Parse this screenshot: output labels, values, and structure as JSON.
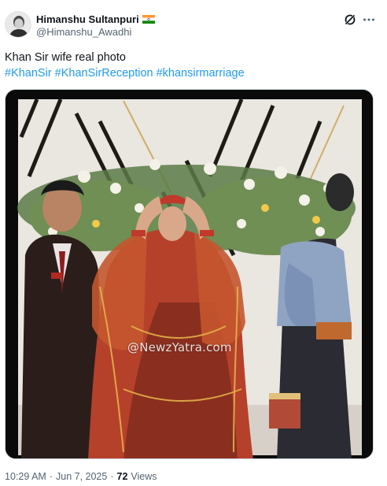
{
  "author": {
    "display_name": "Himanshu Sultanpuri",
    "handle": "@Himanshu_Awadhi"
  },
  "tweet": {
    "text": "Khan Sir wife real photo",
    "hashtags": [
      "#KhanSir",
      "#KhanSirReception",
      "#khansirmarriage"
    ]
  },
  "media": {
    "watermark": "@NewzYatra.com"
  },
  "footer": {
    "time": "10:29 AM",
    "date": "Jun 7, 2025",
    "sep": "·",
    "views_count": "72",
    "views_label": "Views"
  },
  "icons": {
    "grok": "grok-icon",
    "more": "more-icon",
    "flag": "india-flag-icon"
  },
  "colors": {
    "link": "#1d9bf0",
    "secondary_text": "#536471",
    "primary_text": "#0f1419"
  }
}
